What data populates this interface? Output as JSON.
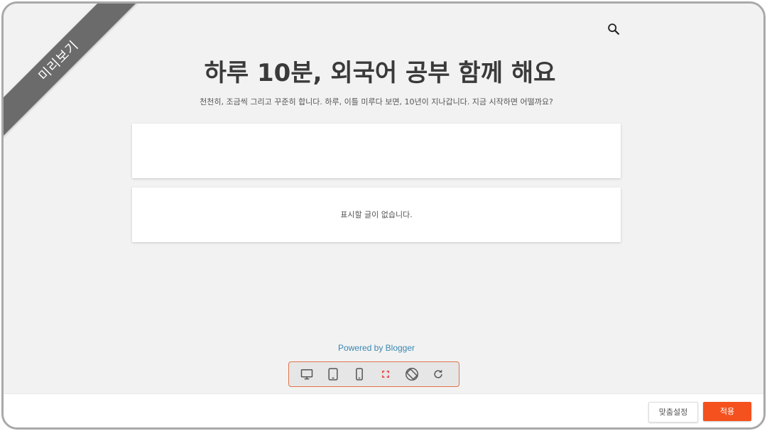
{
  "preview": {
    "ribbon_label": "미리보기",
    "search_icon": "search-icon"
  },
  "blog": {
    "title": "하루 10분, 외국어 공부 함께 해요",
    "description": "천천히, 조금씩 그리고 꾸준히 합니다. 하루, 이틀 미루다 보면, 10년이 지나갑니다. 지금 시작하면 어떨까요?",
    "empty_message": "표시할 글이 없습니다.",
    "powered_by": "Powered by Blogger"
  },
  "device_toolbar": {
    "buttons": [
      "desktop-icon",
      "tablet-icon",
      "phone-icon",
      "fullscreen-icon",
      "rotate-icon",
      "refresh-icon"
    ]
  },
  "footer": {
    "customize_label": "맞춤설정",
    "apply_label": "적용"
  },
  "colors": {
    "accent": "#f4511e",
    "link": "#3b87b1",
    "ribbon": "#6b6b6b",
    "toolbar_border": "#e0734a"
  }
}
